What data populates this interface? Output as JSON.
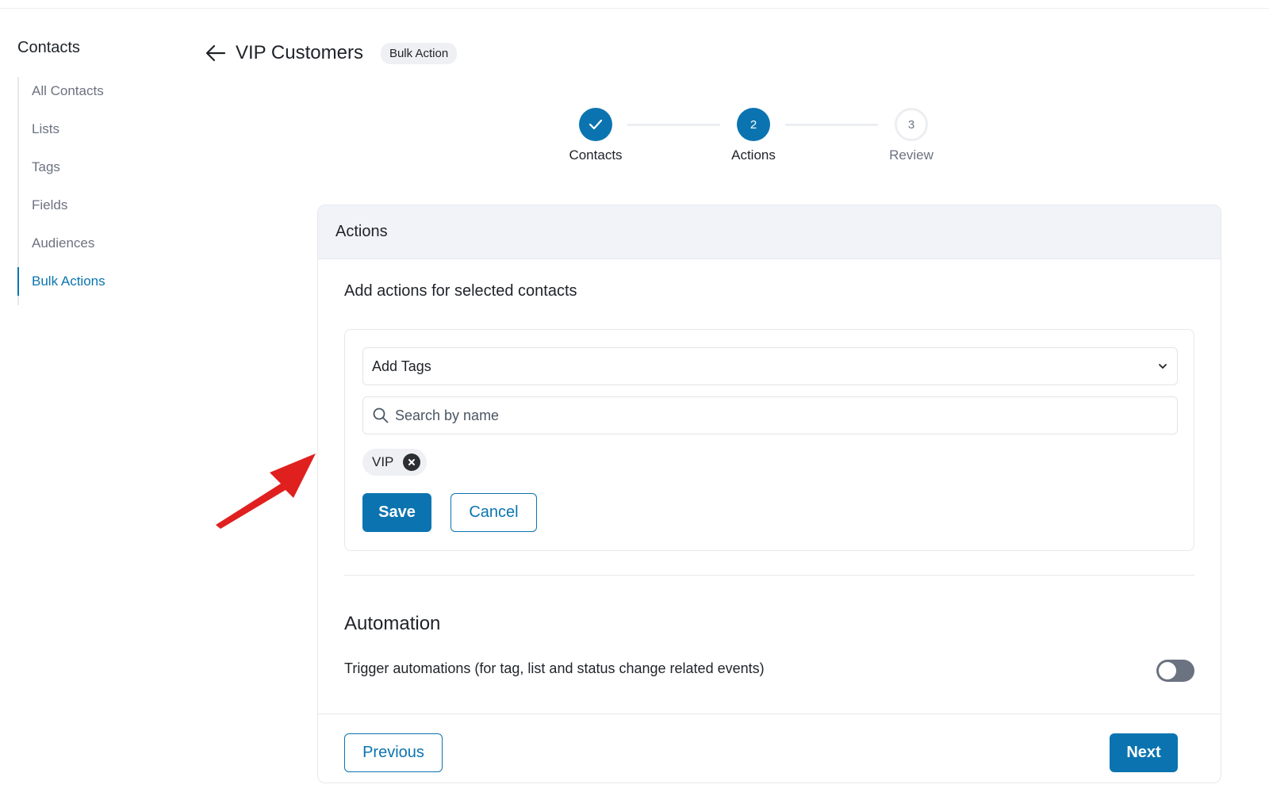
{
  "sidebar": {
    "title": "Contacts",
    "items": [
      {
        "label": "All Contacts",
        "active": false
      },
      {
        "label": "Lists",
        "active": false
      },
      {
        "label": "Tags",
        "active": false
      },
      {
        "label": "Fields",
        "active": false
      },
      {
        "label": "Audiences",
        "active": false
      },
      {
        "label": "Bulk Actions",
        "active": true
      }
    ]
  },
  "header": {
    "title": "VIP Customers",
    "badge": "Bulk Action",
    "back_icon": "arrow-left-icon"
  },
  "stepper": {
    "steps": [
      {
        "number": "",
        "label": "Contacts",
        "state": "done",
        "icon": "check-icon"
      },
      {
        "number": "2",
        "label": "Actions",
        "state": "current"
      },
      {
        "number": "3",
        "label": "Review",
        "state": "pending"
      }
    ]
  },
  "card": {
    "header": "Actions",
    "subtitle": "Add actions for selected contacts",
    "action_select": {
      "value": "Add Tags",
      "icon": "chevron-down-icon"
    },
    "search": {
      "placeholder": "Search by name",
      "value": "",
      "icon": "search-icon"
    },
    "chips": [
      {
        "label": "VIP",
        "remove_icon": "close-circle-icon"
      }
    ],
    "save_label": "Save",
    "cancel_label": "Cancel",
    "automation": {
      "title": "Automation",
      "description": "Trigger automations (for tag, list and status change related events)",
      "enabled": false
    },
    "previous_label": "Previous",
    "next_label": "Next"
  },
  "colors": {
    "accent": "#0b74b0",
    "annotation_arrow": "#e0201f",
    "card_header_bg": "#f1f3f9"
  }
}
